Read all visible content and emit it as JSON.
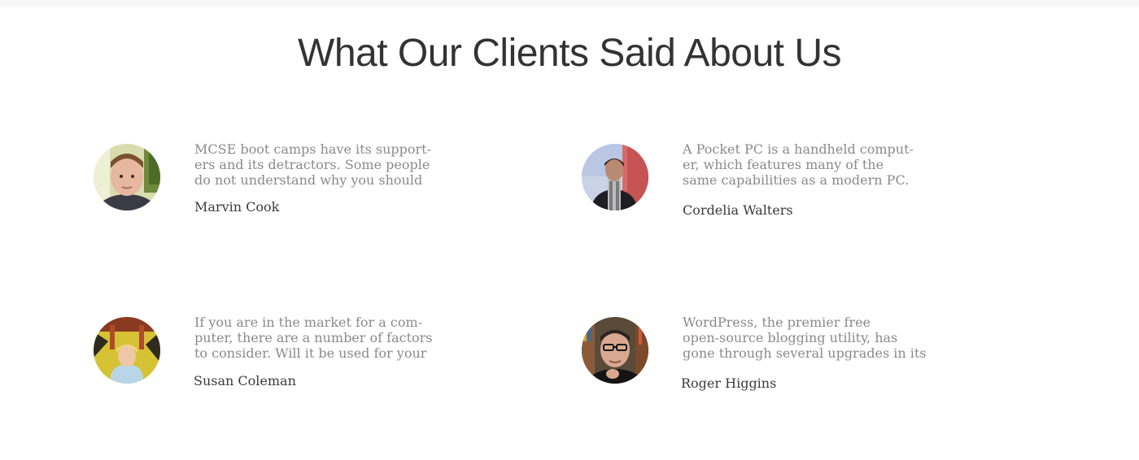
{
  "section": {
    "title": "What Our Clients Said About Us"
  },
  "testimonials": [
    {
      "quote_lines": [
        "MCSE boot camps have its support-",
        "ers and its detractors. Some people",
        "do not understand why you should"
      ],
      "author": "Marvin Cook",
      "avatar_icon": "avatar-young-man-icon"
    },
    {
      "quote_lines": [
        "A Pocket PC is a handheld comput-",
        "er, which features many of the",
        "same capabilities as a modern PC."
      ],
      "author": "Cordelia Walters",
      "avatar_icon": "avatar-woman-scarf-icon"
    },
    {
      "quote_lines": [
        "If you are in the market for a com-",
        "puter, there are a number of factors",
        "to consider. Will it be used for your"
      ],
      "author": "Susan Coleman",
      "avatar_icon": "avatar-girl-yellow-icon"
    },
    {
      "quote_lines": [
        "WordPress, the premier free",
        "open-source blogging utility, has",
        "gone through several upgrades in its"
      ],
      "author": "Roger Higgins",
      "avatar_icon": "avatar-man-glasses-icon"
    }
  ]
}
